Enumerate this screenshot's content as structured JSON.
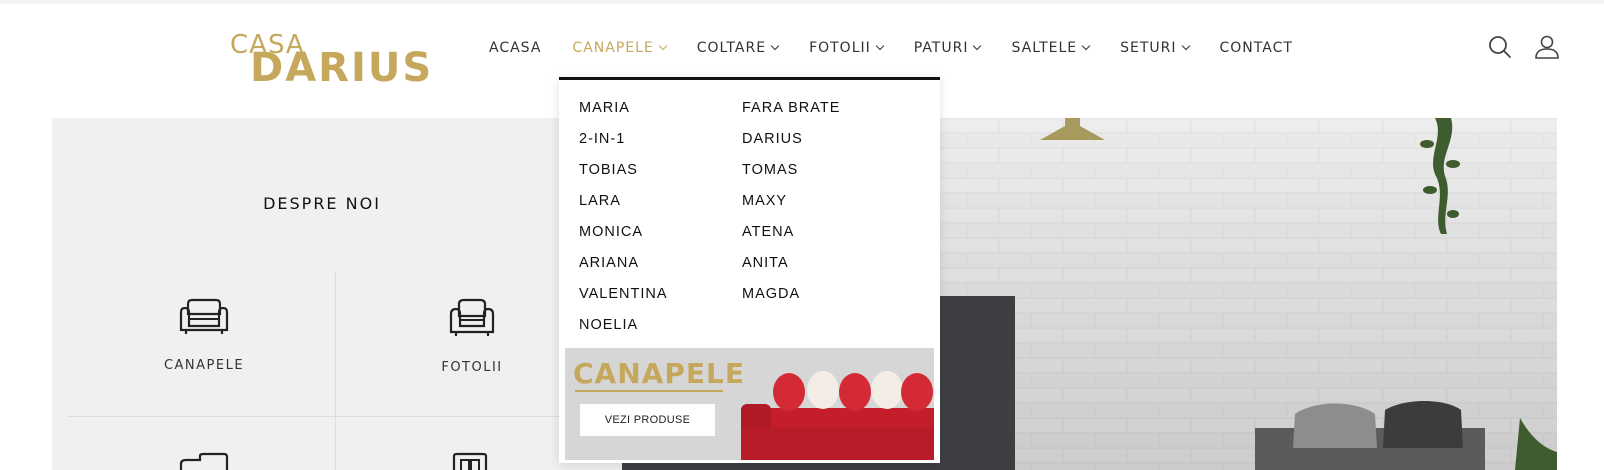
{
  "brand": {
    "line1": "CASA",
    "line2": "DARIUS",
    "color": "#c6a85c"
  },
  "nav": {
    "items": [
      {
        "label": "ACASA",
        "dropdown": false
      },
      {
        "label": "CANAPELE",
        "dropdown": true,
        "active": true
      },
      {
        "label": "COLTARE",
        "dropdown": true
      },
      {
        "label": "FOTOLII",
        "dropdown": true
      },
      {
        "label": "PATURI",
        "dropdown": true
      },
      {
        "label": "SALTELE",
        "dropdown": true
      },
      {
        "label": "SETURI",
        "dropdown": true
      },
      {
        "label": "CONTACT",
        "dropdown": false
      }
    ],
    "active_color": "#c6a85c"
  },
  "header_icons": [
    "search-icon",
    "user-icon"
  ],
  "dropdown": {
    "col1": [
      "MARIA",
      "2-IN-1",
      "TOBIAS",
      "LARA",
      "MONICA",
      "ARIANA",
      "VALENTINA",
      "NOELIA"
    ],
    "col2": [
      "FARA BRATE",
      "DARIUS",
      "TOMAS",
      "MAXY",
      "ATENA",
      "ANITA",
      "MAGDA"
    ],
    "promo": {
      "title": "CANAPELE",
      "button": "VEZI PRODUSE"
    }
  },
  "about": {
    "title": "DESPRE NOI",
    "categories": [
      {
        "label": "CANAPELE",
        "icon": "sofa-icon"
      },
      {
        "label": "FOTOLII",
        "icon": "armchair-icon"
      }
    ]
  }
}
